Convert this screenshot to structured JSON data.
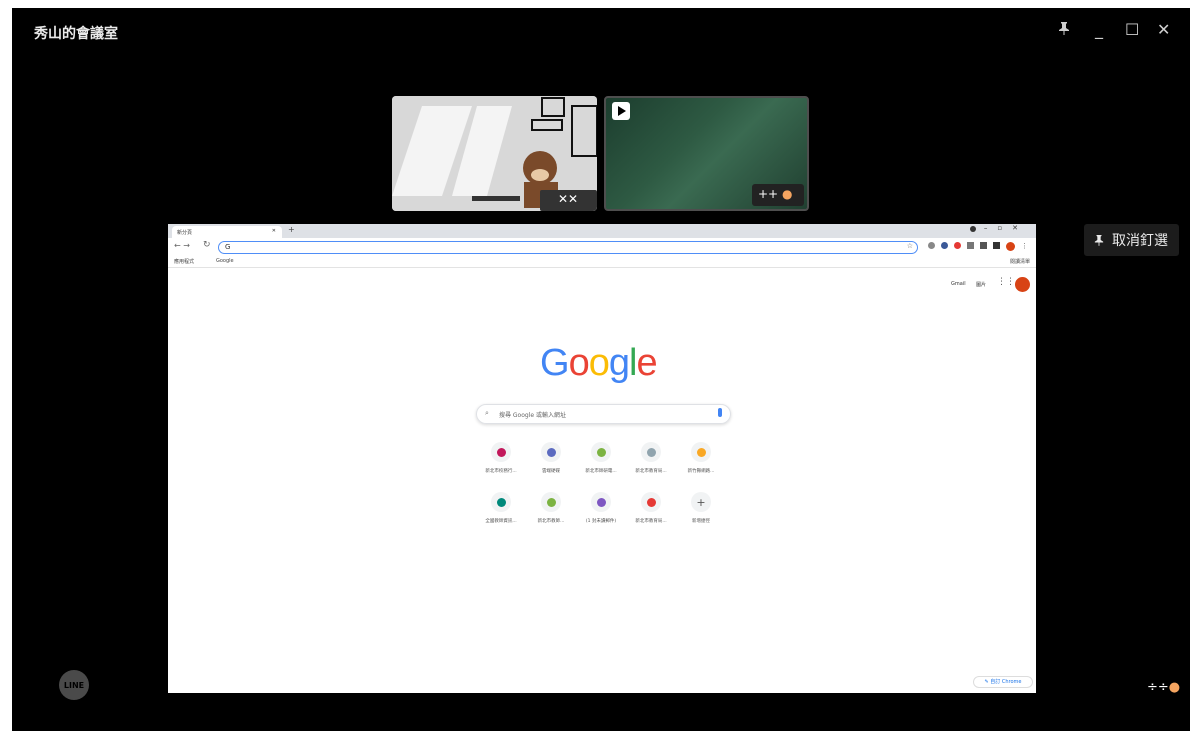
{
  "window": {
    "title": "秀山的會議室",
    "controls": {
      "pin_icon": "pin-icon",
      "minimize": "_",
      "maximize": "☐",
      "close": "✕"
    }
  },
  "sidebar": {
    "unpin_label": "取消釘選",
    "unpin_icon": "pin-icon"
  },
  "thumbnails": [
    {
      "name": "camera-bear-room",
      "badge": "✕✕"
    },
    {
      "name": "camera-chalkboard",
      "badge": "++"
    }
  ],
  "shared_screen": {
    "browser": {
      "tab_title": "新分頁",
      "tab_close": "✕",
      "new_tab": "+",
      "omnibox_text": "G",
      "bookmarks": [
        "應用程式",
        "Google"
      ],
      "reading_list": "閱讀清單",
      "top_right_links": [
        "Gmail",
        "圖片"
      ]
    },
    "google": {
      "logo_letters": [
        {
          "ch": "G",
          "color": "#4285F4"
        },
        {
          "ch": "o",
          "color": "#EA4335"
        },
        {
          "ch": "o",
          "color": "#FBBC05"
        },
        {
          "ch": "g",
          "color": "#4285F4"
        },
        {
          "ch": "l",
          "color": "#34A853"
        },
        {
          "ch": "e",
          "color": "#EA4335"
        }
      ],
      "search_placeholder": "搜尋 Google 或輸入網址"
    },
    "shortcuts": [
      {
        "label": "新北市校務行...",
        "color": "#c2185b"
      },
      {
        "label": "雲端硬碟",
        "color": "#5c6bc0"
      },
      {
        "label": "新北市師研電...",
        "color": "#7cb342"
      },
      {
        "label": "新北市教育局...",
        "color": "#90a4ae"
      },
      {
        "label": "新竹縣網路...",
        "color": "#f9a825"
      },
      {
        "label": "全國教師資訊...",
        "color": "#00897b"
      },
      {
        "label": "新北市教師...",
        "color": "#7cb342"
      },
      {
        "label": "(1 封未讀郵件)",
        "color": "#7e57c2"
      },
      {
        "label": "新北市教育局...",
        "color": "#e53935"
      },
      {
        "label": "新增捷徑",
        "color": "#bdbdbd"
      }
    ],
    "customize_label": "自訂 Chrome"
  },
  "branding": {
    "line_logo": "LINE"
  },
  "colors": {
    "background": "#000000",
    "accent": "#4f8ef7"
  }
}
